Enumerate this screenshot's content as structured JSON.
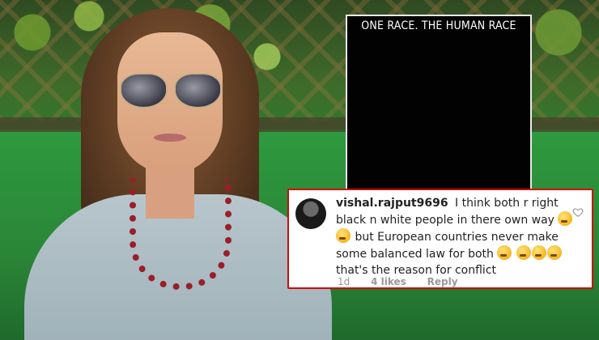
{
  "story": {
    "text": "ONE RACE. THE HUMAN RACE"
  },
  "comment": {
    "username": "vishal.rajput9696",
    "segments": [
      "I think both r right black n white people in there own way",
      "but European countries never make some balanced law for both",
      "that's the reason for conflict"
    ],
    "time": "1d",
    "likes": "4 likes",
    "reply_label": "Reply",
    "heart_icon": "heart-outline-icon",
    "emoji_icon": "thinking-face-emoji"
  }
}
